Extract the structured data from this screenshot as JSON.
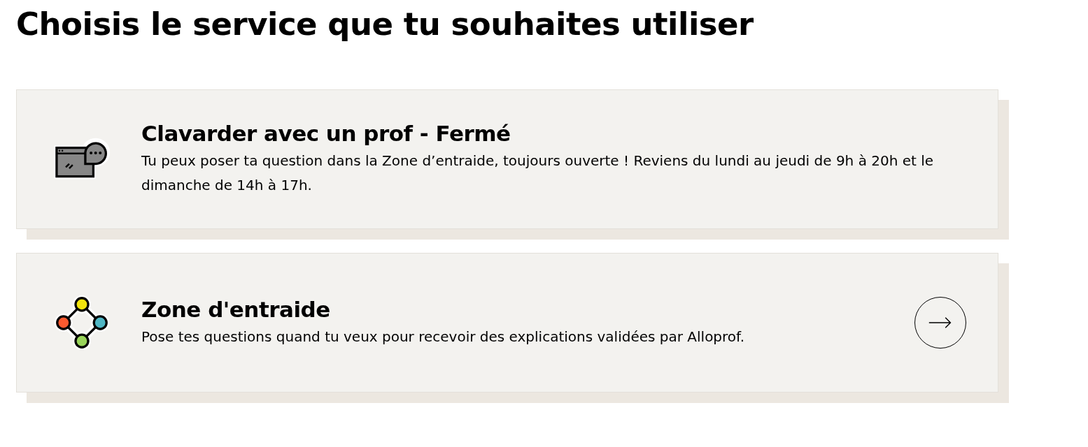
{
  "heading": "Choisis le service que tu souhaites utiliser",
  "services": [
    {
      "kind": "chat",
      "title": "Clavarder avec un prof - Fermé",
      "description": "Tu peux poser ta question dans la Zone d’entraide, toujours ouverte ! Reviens du lundi au jeudi de 9h à 20h et le dimanche de 14h à 17h.",
      "link": false
    },
    {
      "kind": "network",
      "title": "Zone d'entraide",
      "description": "Pose tes questions quand tu veux pour recevoir des explications validées par Alloprof.",
      "link": true
    }
  ]
}
